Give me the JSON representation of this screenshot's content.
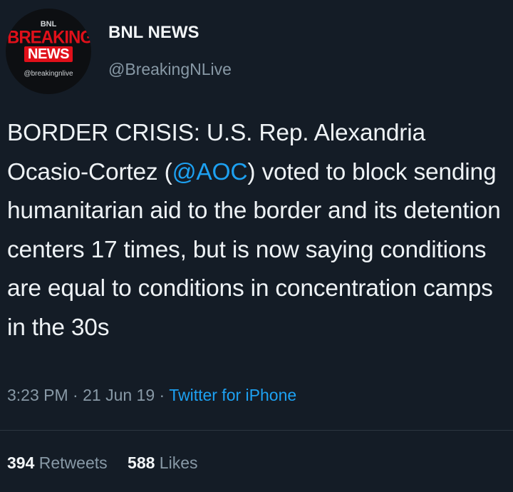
{
  "account": {
    "name": "BNL NEWS",
    "handle": "@BreakingNLive",
    "avatar": {
      "top": "BNL",
      "line1": "BREAKING",
      "line2": "NEWS",
      "handle": "@breakingnlive"
    }
  },
  "tweet": {
    "text_before": "BORDER CRISIS: U.S. Rep. Alexandria Ocasio-Cortez (",
    "mention": "@AOC",
    "text_after": ") voted to block sending humanitarian aid to the border and its detention centers 17 times, but is now saying conditions are equal to conditions in concentration camps in the 30s",
    "time": "3:23 PM",
    "separator": "·",
    "date": "21 Jun 19",
    "source": "Twitter for iPhone"
  },
  "stats": {
    "retweets_count": "394",
    "retweets_label": "Retweets",
    "likes_count": "588",
    "likes_label": "Likes"
  },
  "colors": {
    "background": "#141c26",
    "link": "#1da1f2",
    "muted": "#8899a6",
    "brand_red": "#e0101a"
  }
}
